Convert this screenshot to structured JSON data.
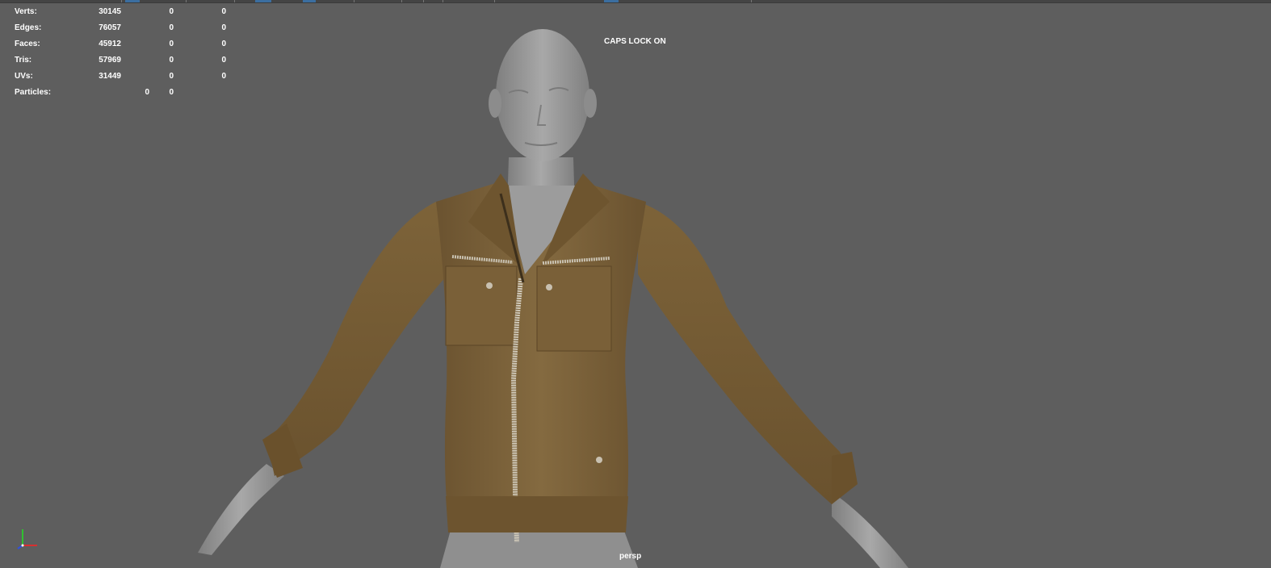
{
  "hud": {
    "rows": [
      {
        "label": "Verts:",
        "v1": "30145",
        "v2": "0",
        "v3": "0"
      },
      {
        "label": "Edges:",
        "v1": "76057",
        "v2": "0",
        "v3": "0"
      },
      {
        "label": "Faces:",
        "v1": "45912",
        "v2": "0",
        "v3": "0"
      },
      {
        "label": "Tris:",
        "v1": "57969",
        "v2": "0",
        "v3": "0"
      },
      {
        "label": "UVs:",
        "v1": "31449",
        "v2": "0",
        "v3": "0"
      }
    ],
    "particles": {
      "label": "Particles:",
      "v1": "0",
      "v2": "0"
    }
  },
  "status": {
    "caps_lock": "CAPS LOCK ON"
  },
  "camera": {
    "name": "persp"
  },
  "colors": {
    "viewport_bg": "#5e5e5e",
    "hud_text": "#ffffff",
    "skin": "#9a9a9a",
    "jacket": "#7a5f35",
    "zipper": "#cfc8b8",
    "axis_x": "#d83030",
    "axis_y": "#30c030",
    "axis_z": "#3050e0"
  },
  "icons": {
    "axis_gizmo": "xyz-axis-icon"
  }
}
